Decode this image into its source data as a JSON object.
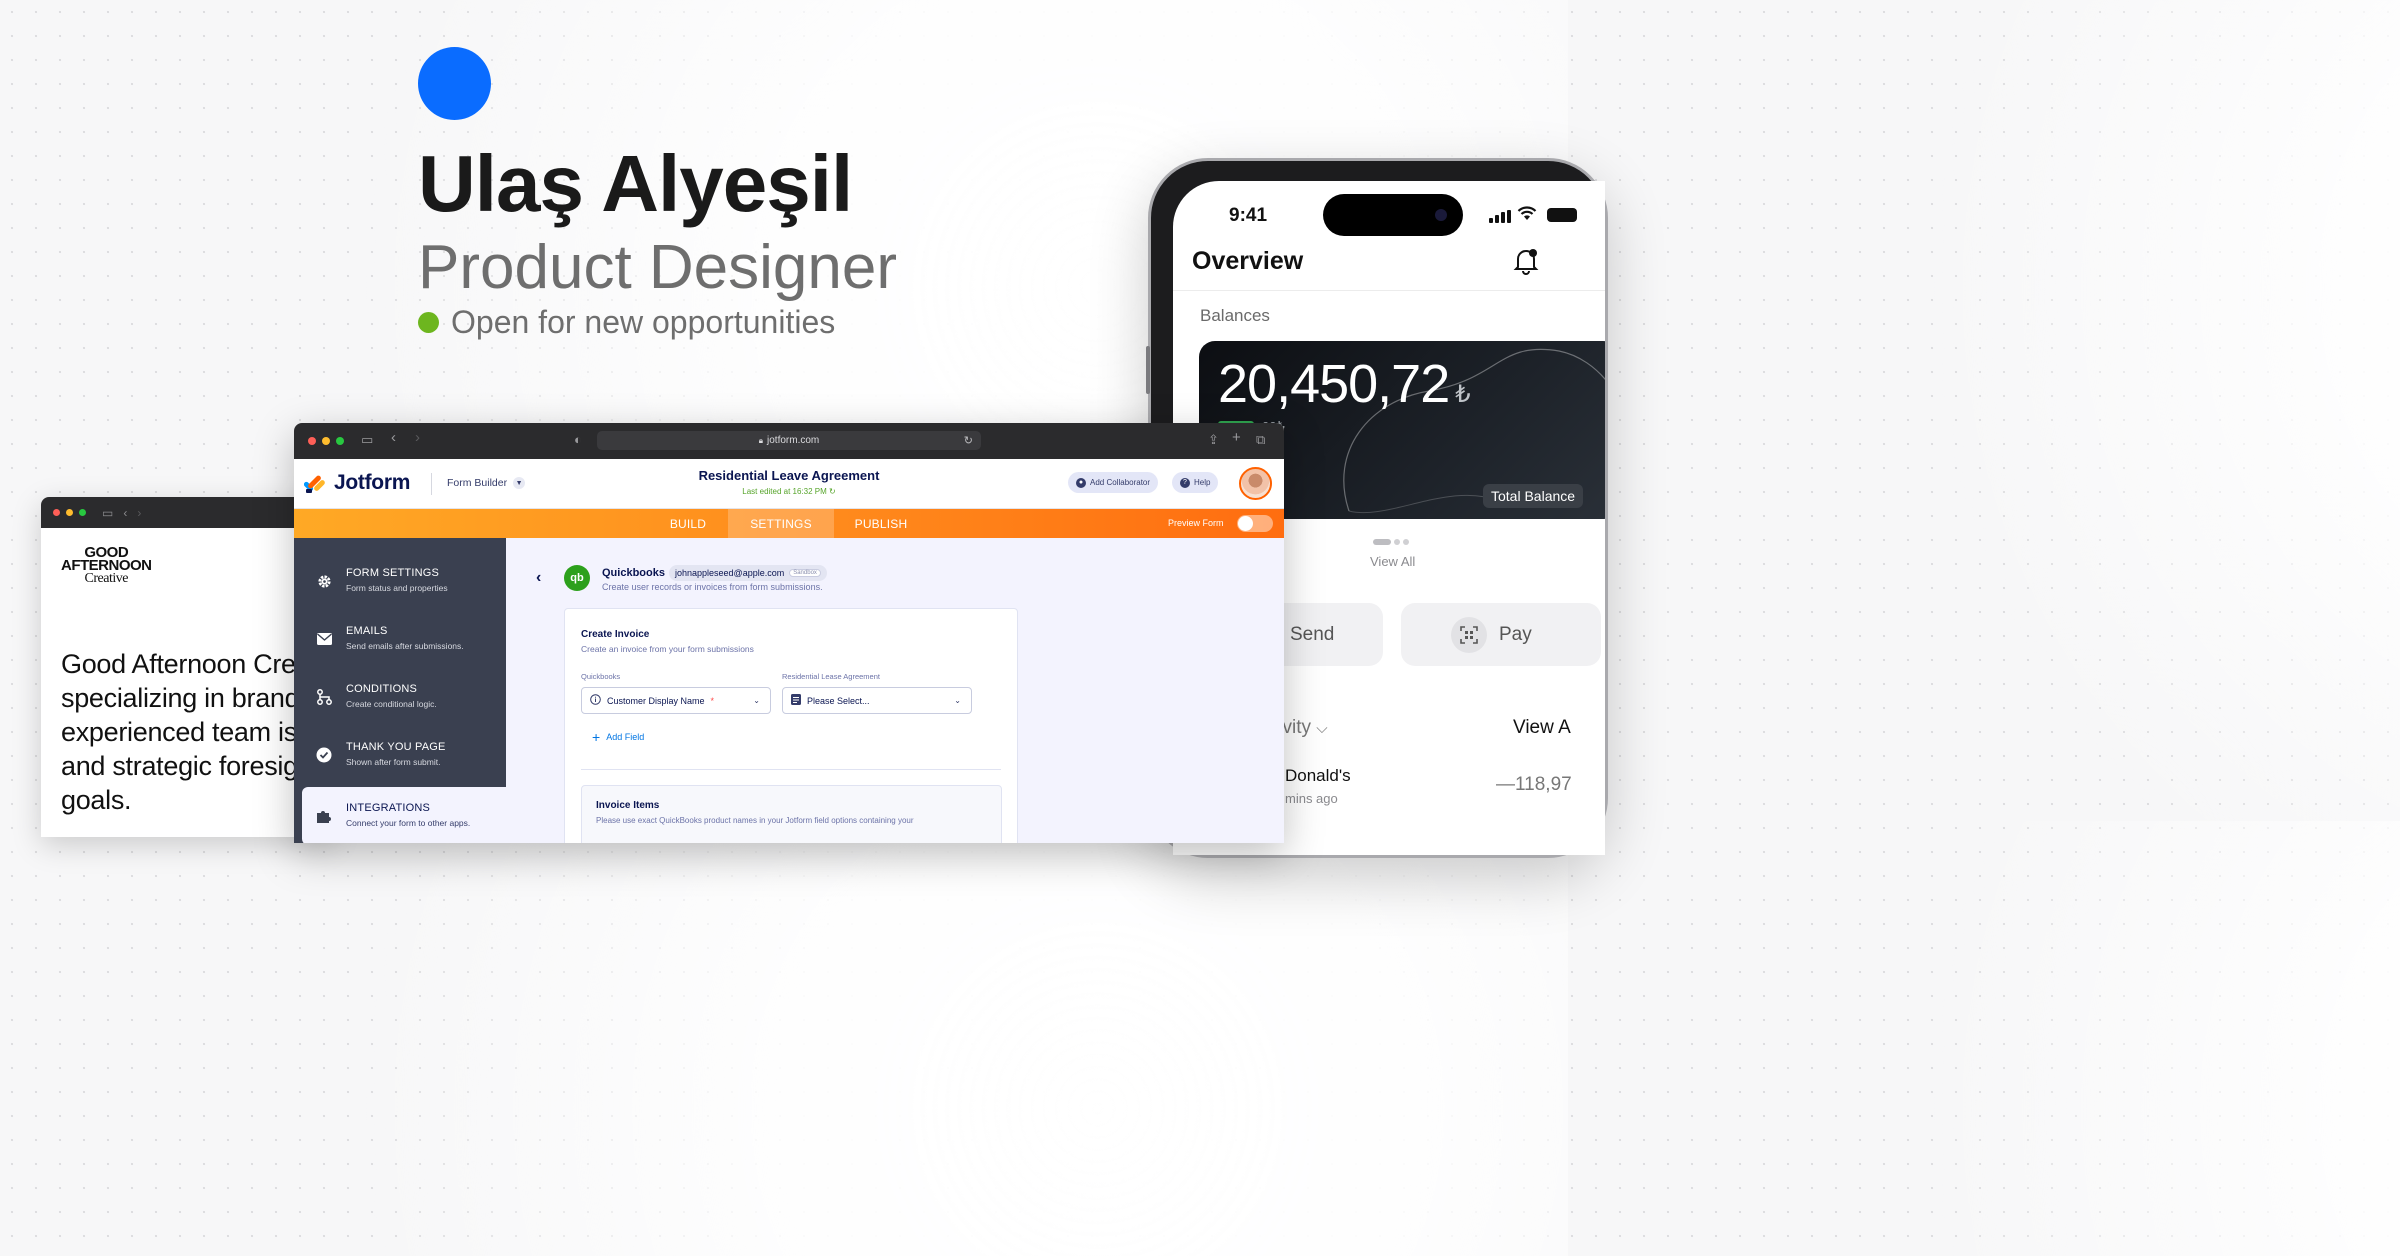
{
  "hero": {
    "name": "Ulaş Alyeşil",
    "role": "Product Designer",
    "status": "Open for new opportunities",
    "accent_color": "#0a6cff",
    "status_color": "#6db61f"
  },
  "left_window": {
    "logo_line1": "GOOD",
    "logo_line2": "AFTERNOON",
    "logo_line3": "Creative",
    "body_lines": [
      "Good Afternoon Cre",
      "specializing in brand",
      "experienced team is",
      "and strategic foresig",
      "goals."
    ]
  },
  "phone": {
    "time": "9:41",
    "title": "Overview",
    "section": "Balances",
    "amount": "20,450,72",
    "currency": "₺",
    "sub_amount": "00₺",
    "total_balance": "Total Balance",
    "view_all": "View All",
    "send": "Send",
    "pay": "Pay",
    "activity": "tivity",
    "view_a": "View A",
    "donald": "Donald's",
    "mins_ago": "mins ago",
    "neg_amount": "—118,97"
  },
  "browser": {
    "url": "jotform.com"
  },
  "jotform": {
    "logo": "Jotform",
    "builder_label": "Form Builder",
    "form_title": "Residential Leave Agreement",
    "last_edited": "Last edited at 16:32 PM",
    "add_collaborator": "Add Collaborator",
    "help": "Help",
    "tabs": [
      "BUILD",
      "SETTINGS",
      "PUBLISH"
    ],
    "active_tab": "SETTINGS",
    "preview_form": "Preview Form",
    "sidebar": [
      {
        "title": "FORM SETTINGS",
        "desc": "Form status and properties",
        "icon": "gear-icon"
      },
      {
        "title": "EMAILS",
        "desc": "Send emails after submissions.",
        "icon": "envelope-icon"
      },
      {
        "title": "CONDITIONS",
        "desc": "Create conditional logic.",
        "icon": "branch-icon"
      },
      {
        "title": "THANK YOU PAGE",
        "desc": "Shown after form submit.",
        "icon": "check-circle-icon"
      },
      {
        "title": "INTEGRATIONS",
        "desc": "Connect your form to other apps.",
        "icon": "puzzle-icon"
      }
    ],
    "integration": {
      "logo_text": "qb",
      "name": "Quickbooks",
      "email": "johnappleseed@apple.com",
      "sandbox": "Sandbox",
      "desc": "Create user records or invoices from form submissions.",
      "color": "#2ca01c"
    },
    "invoice": {
      "title": "Create Invoice",
      "desc": "Create an invoice from your form submissions",
      "label_left": "Quickbooks",
      "label_right": "Residential Lease Agreement",
      "select_left": "Customer Display Name",
      "required_mark": "*",
      "select_right": "Please Select...",
      "add_field": "Add Field",
      "items_title": "Invoice Items",
      "items_desc": "Please use exact QuickBooks product names in your Jotform field options containing your"
    }
  }
}
